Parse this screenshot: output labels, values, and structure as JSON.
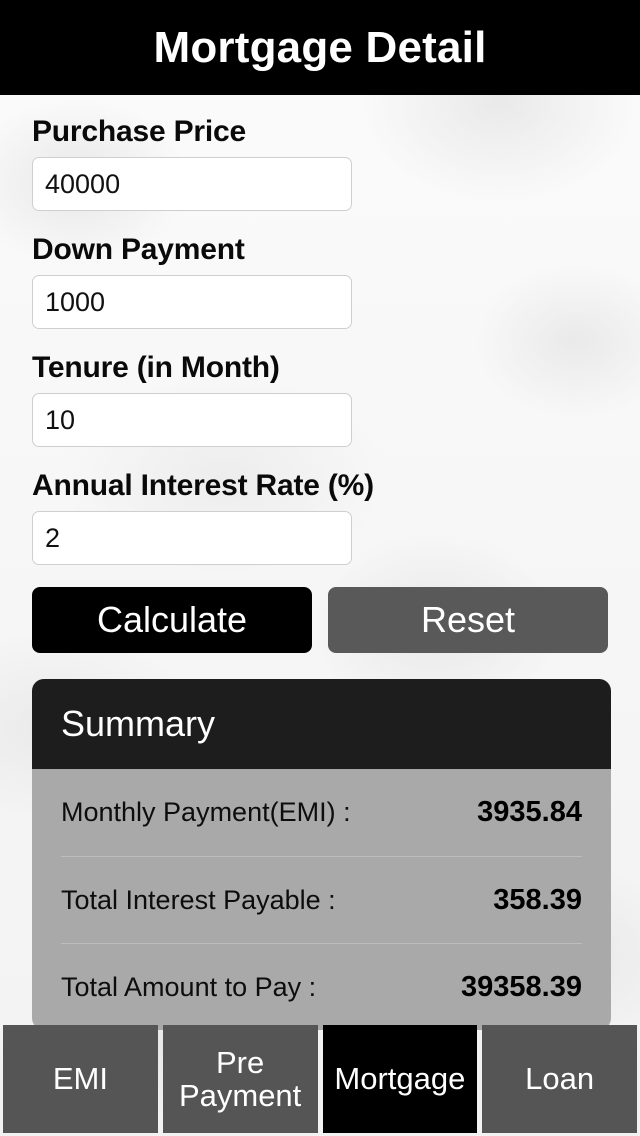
{
  "header": {
    "title": "Mortgage Detail"
  },
  "form": {
    "fields": [
      {
        "label": "Purchase Price",
        "value": "40000",
        "placeholder": ""
      },
      {
        "label": "Down Payment",
        "value": "1000",
        "placeholder": ""
      },
      {
        "label": "Tenure (in Month)",
        "value": "10",
        "placeholder": ""
      },
      {
        "label": "Annual Interest Rate (%)",
        "value": "2",
        "placeholder": ""
      }
    ],
    "calculate_label": "Calculate",
    "reset_label": "Reset"
  },
  "summary": {
    "title": "Summary",
    "rows": [
      {
        "label": "Monthly Payment(EMI) :",
        "value": "3935.84"
      },
      {
        "label": "Total Interest Payable :",
        "value": "358.39"
      },
      {
        "label": "Total Amount to Pay :",
        "value": "39358.39"
      }
    ]
  },
  "tabbar": {
    "tabs": [
      {
        "label": "EMI",
        "active": false
      },
      {
        "label": "Pre\nPayment",
        "active": false
      },
      {
        "label": "Mortgage",
        "active": true
      },
      {
        "label": "Loan",
        "active": false
      }
    ]
  },
  "colors": {
    "navbar_bg": "#000000",
    "primary_button_bg": "#000000",
    "secondary_button_bg": "#595959",
    "summary_header_bg": "#1d1d1d",
    "summary_body_bg": "#a9a9a9",
    "tab_bg": "#555555",
    "tab_active_bg": "#000000",
    "page_bg": "#f6f6f6"
  }
}
